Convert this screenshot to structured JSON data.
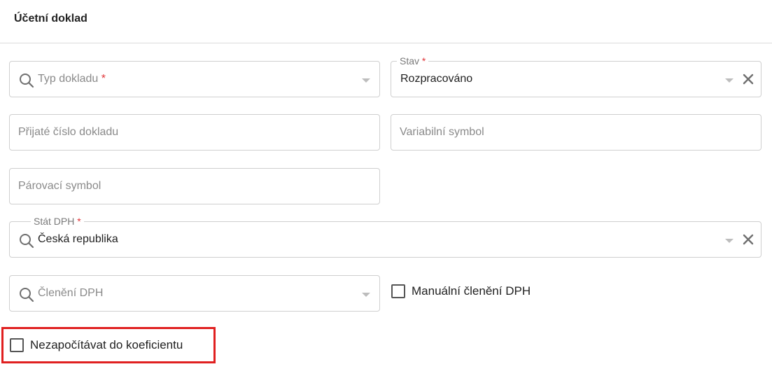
{
  "header": {
    "title": "Účetní doklad"
  },
  "fields": {
    "typ_dokladu": {
      "placeholder": "Typ dokladu",
      "required_mark": "*"
    },
    "stav": {
      "label": "Stav",
      "required_mark": "*",
      "value": "Rozpracováno"
    },
    "prijate_cislo": {
      "placeholder": "Přijaté číslo dokladu"
    },
    "variabilni_symbol": {
      "placeholder": "Variabilní symbol"
    },
    "parovaci_symbol": {
      "placeholder": "Párovací symbol"
    },
    "stat_dph": {
      "label": "Stát DPH",
      "required_mark": "*",
      "value": "Česká republika"
    },
    "cleneni_dph": {
      "placeholder": "Členění DPH"
    }
  },
  "checkboxes": {
    "manualni_cleneni": {
      "label": "Manuální členění DPH",
      "checked": false
    },
    "nezapocitavat": {
      "label": "Nezapočítávat do koeficientu",
      "checked": false
    }
  },
  "icons": {
    "search": "search-icon",
    "caret": "chevron-down-icon",
    "clear": "close-icon"
  },
  "colors": {
    "required": "#e0363a",
    "highlight": "#e02020",
    "border": "#cfcfcf"
  }
}
